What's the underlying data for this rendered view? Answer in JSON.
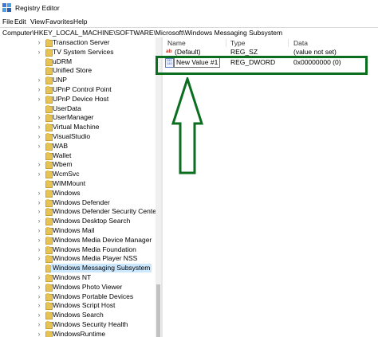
{
  "window": {
    "title": "Registry Editor",
    "icon": "registry-icon"
  },
  "menu": [
    "File",
    "Edit",
    "View",
    "Favorites",
    "Help"
  ],
  "address": "Computer\\HKEY_LOCAL_MACHINE\\SOFTWARE\\Microsoft\\Windows Messaging Subsystem",
  "tree": {
    "items": [
      {
        "label": "Transaction Server",
        "expandable": true
      },
      {
        "label": "TV System Services",
        "expandable": true
      },
      {
        "label": "uDRM",
        "expandable": false
      },
      {
        "label": "Unified Store",
        "expandable": false
      },
      {
        "label": "UNP",
        "expandable": true
      },
      {
        "label": "UPnP Control Point",
        "expandable": true
      },
      {
        "label": "UPnP Device Host",
        "expandable": true
      },
      {
        "label": "UserData",
        "expandable": false
      },
      {
        "label": "UserManager",
        "expandable": true
      },
      {
        "label": "Virtual Machine",
        "expandable": true
      },
      {
        "label": "VisualStudio",
        "expandable": true
      },
      {
        "label": "WAB",
        "expandable": true
      },
      {
        "label": "Wallet",
        "expandable": false
      },
      {
        "label": "Wbem",
        "expandable": true
      },
      {
        "label": "WcmSvc",
        "expandable": true
      },
      {
        "label": "WIMMount",
        "expandable": false
      },
      {
        "label": "Windows",
        "expandable": true
      },
      {
        "label": "Windows Defender",
        "expandable": true
      },
      {
        "label": "Windows Defender Security Center",
        "expandable": true
      },
      {
        "label": "Windows Desktop Search",
        "expandable": true
      },
      {
        "label": "Windows Mail",
        "expandable": true
      },
      {
        "label": "Windows Media Device Manager",
        "expandable": true
      },
      {
        "label": "Windows Media Foundation",
        "expandable": true
      },
      {
        "label": "Windows Media Player NSS",
        "expandable": true
      },
      {
        "label": "Windows Messaging Subsystem",
        "expandable": false,
        "selected": true
      },
      {
        "label": "Windows NT",
        "expandable": true
      },
      {
        "label": "Windows Photo Viewer",
        "expandable": true
      },
      {
        "label": "Windows Portable Devices",
        "expandable": true
      },
      {
        "label": "Windows Script Host",
        "expandable": true
      },
      {
        "label": "Windows Search",
        "expandable": true
      },
      {
        "label": "Windows Security Health",
        "expandable": true
      },
      {
        "label": "WindowsRuntime",
        "expandable": true
      }
    ]
  },
  "list": {
    "headers": {
      "name": "Name",
      "type": "Type",
      "data": "Data"
    },
    "rows": [
      {
        "icon": "string-value-icon",
        "name": "(Default)",
        "type": "REG_SZ",
        "data": "(value not set)"
      },
      {
        "icon": "binary-value-icon",
        "name": "New Value #1",
        "type": "REG_DWORD",
        "data": "0x00000000 (0)",
        "editing": true
      }
    ]
  },
  "annotation": {
    "color": "#0b6e1f",
    "shape": "up-arrow-and-box"
  }
}
